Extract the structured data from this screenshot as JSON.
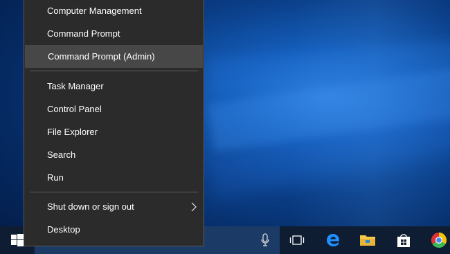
{
  "menu": {
    "items": [
      {
        "label": "Computer Management"
      },
      {
        "label": "Command Prompt"
      },
      {
        "label": "Command Prompt (Admin)",
        "highlighted": true
      },
      {
        "label": "Task Manager"
      },
      {
        "label": "Control Panel"
      },
      {
        "label": "File Explorer"
      },
      {
        "label": "Search"
      },
      {
        "label": "Run"
      },
      {
        "label": "Shut down or sign out",
        "has_submenu": true
      },
      {
        "label": "Desktop"
      }
    ]
  },
  "taskbar": {
    "icons": [
      "windows-start-icon",
      "microphone-icon",
      "task-view-icon",
      "edge-icon",
      "file-explorer-icon",
      "store-icon",
      "chrome-icon"
    ]
  },
  "colors": {
    "menu_bg": "#2b2b2b",
    "menu_highlight": "#474747",
    "taskbar_bg": "#0f1d33",
    "search_bg": "#1b3a66",
    "accent": "#0a5fc4"
  }
}
